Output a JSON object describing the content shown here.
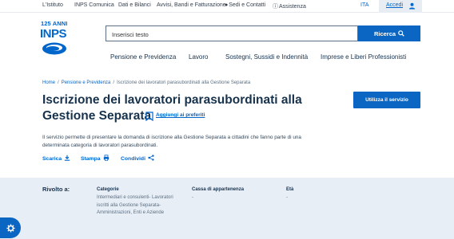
{
  "topbar": {
    "links": [
      "L'Istituto",
      "INPS Comunica",
      "Dati e Bilanci",
      "Avvisi, Bandi e Fatturazione",
      "Sedi e Contatti",
      "Assistenza"
    ],
    "lang": "ITA",
    "login": "Accedi"
  },
  "logo": {
    "anniversary": "125 ANNI",
    "name": "INPS"
  },
  "search": {
    "placeholder": "Inserisci testo",
    "button": "Ricerca"
  },
  "nav": [
    "Pensione e Previdenza",
    "Lavoro",
    "Sostegni, Sussidi e Indennità",
    "Imprese e Liberi Professionisti"
  ],
  "breadcrumb": {
    "home": "Home",
    "section": "Pensione e Previdenza",
    "current": "Iscrizione dei lavoratori parasubordinati alla Gestione Separata"
  },
  "page": {
    "title_line1": "Iscrizione dei lavoratori parasubordinati alla",
    "title_line2": "Gestione Separata",
    "favorite": "Aggiungi ai preferiti",
    "cta": "Utilizza il servizio",
    "description": "Il servizio permette di presentare la domanda di iscrizione alla Gestione Separata a cittadini che fanno parte di una determinata categoria di lavoratori parasubordinati."
  },
  "actions": {
    "download": "Scarica",
    "print": "Stampa",
    "share": "Condividi"
  },
  "audience": {
    "label": "Rivolto a:",
    "categoria_label": "Categorie",
    "categoria_line1": "Intermediari e consulenti- Lavoratori",
    "categoria_line2": "iscritti alla Gestione Separata-",
    "categoria_line3": "Amministrazioni, Enti e Aziende",
    "cassa_label": "Cassa di appartenenza",
    "cassa_value": "-",
    "eta_label": "Età",
    "eta_value": "-"
  },
  "colors": {
    "primary": "#0a66c2",
    "heading": "#17324d",
    "panel": "#e8eef6"
  }
}
